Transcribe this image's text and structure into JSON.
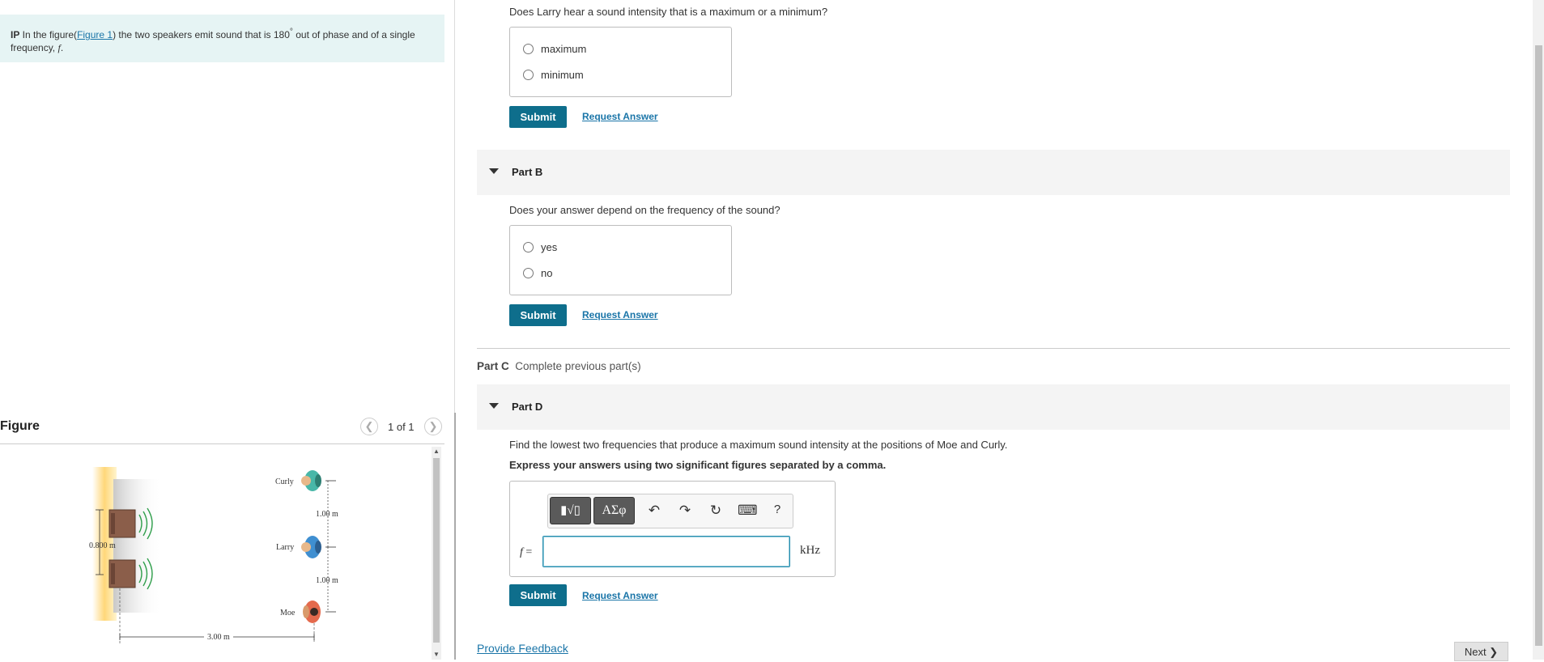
{
  "problem": {
    "prefix": "IP",
    "text_before_link": " In the figure(",
    "figure_link": "Figure 1",
    "text_after_link": ") the two speakers emit sound that is 180",
    "degree": "°",
    "text_end": " out of phase and of a single frequency, ",
    "variable": "f",
    "period": "."
  },
  "figure": {
    "title": "Figure",
    "counter": "1 of 1",
    "labels": {
      "curly": "Curly",
      "larry": "Larry",
      "moe": "Moe",
      "d1": "1.00 m",
      "d2": "1.00 m",
      "speaker_sep": "0.800 m",
      "horiz": "3.00 m"
    }
  },
  "part_a": {
    "question": "Does Larry hear a sound intensity that is a maximum or a minimum?",
    "options": [
      "maximum",
      "minimum"
    ],
    "submit": "Submit",
    "request": "Request Answer"
  },
  "part_b": {
    "title": "Part B",
    "question": "Does your answer depend on the frequency of the sound?",
    "options": [
      "yes",
      "no"
    ],
    "submit": "Submit",
    "request": "Request Answer"
  },
  "part_c": {
    "title": "Part C",
    "status": "Complete previous part(s)"
  },
  "part_d": {
    "title": "Part D",
    "question": "Find the lowest two frequencies that produce a maximum sound intensity at the positions of Moe and Curly.",
    "instruction": "Express your answers using two significant figures separated by a comma.",
    "toolbar": {
      "templates": "▮√▯",
      "greek": "ΑΣφ",
      "undo": "↶",
      "redo": "↷",
      "reset": "↻",
      "keyboard": "⌨",
      "help": "?"
    },
    "answer_label_var": "f",
    "answer_label_eq": " =",
    "answer_value": "",
    "unit": "kHz",
    "submit": "Submit",
    "request": "Request Answer"
  },
  "footer": {
    "feedback": "Provide Feedback",
    "next": "Next ❯"
  }
}
